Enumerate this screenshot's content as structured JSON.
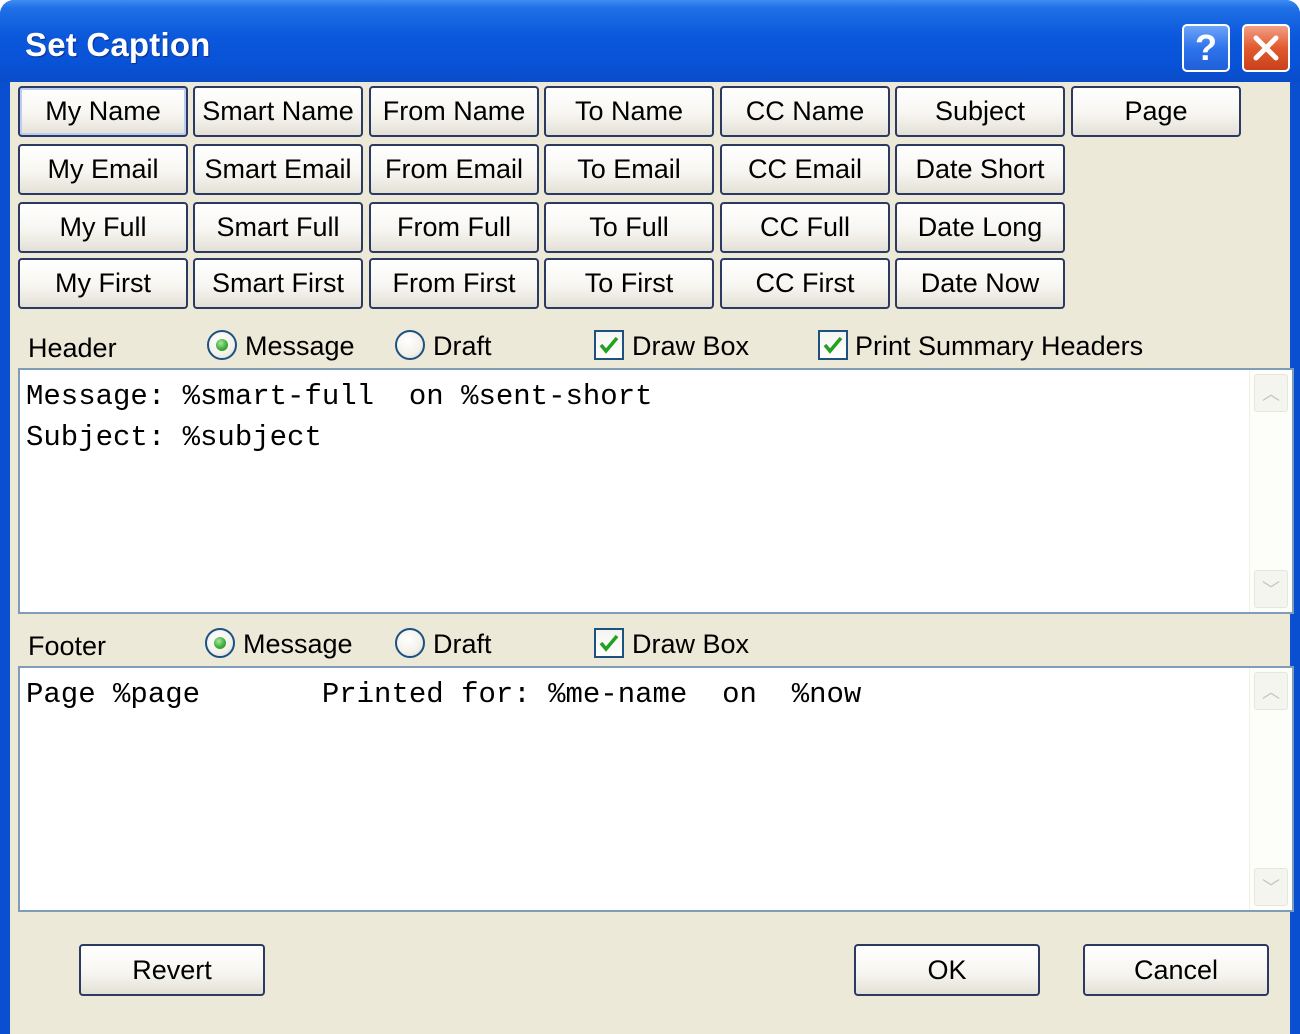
{
  "window": {
    "title": "Set Caption",
    "help_glyph": "?",
    "close_glyph": "✕"
  },
  "macro_buttons": {
    "row1": [
      "My Name",
      "Smart Name",
      "From Name",
      "To Name",
      "CC Name",
      "Subject",
      "Page"
    ],
    "row2": [
      "My Email",
      "Smart Email",
      "From Email",
      "To Email",
      "CC Email",
      "Date Short"
    ],
    "row3": [
      "My Full",
      "Smart Full",
      "From Full",
      "To Full",
      "CC Full",
      "Date Long"
    ],
    "row4": [
      "My First",
      "Smart First",
      "From First",
      "To First",
      "CC First",
      "Date Now"
    ]
  },
  "header": {
    "label": "Header",
    "radio_message": "Message",
    "radio_draft": "Draft",
    "selected_radio": "Message",
    "draw_box": "Draw Box",
    "draw_box_checked": true,
    "print_summary": "Print Summary Headers",
    "print_summary_checked": true,
    "text": "Message: %smart-full  on %sent-short\nSubject: %subject"
  },
  "footer": {
    "label": "Footer",
    "radio_message": "Message",
    "radio_draft": "Draft",
    "selected_radio": "Message",
    "draw_box": "Draw Box",
    "draw_box_checked": true,
    "text": "Page %page       Printed for: %me-name  on  %now"
  },
  "actions": {
    "revert": "Revert",
    "ok": "OK",
    "cancel": "Cancel"
  },
  "colors": {
    "title_bar": "#0852d6",
    "dialog_bg": "#ece9d8",
    "close": "#e25a2e",
    "check_green": "#21a121"
  }
}
